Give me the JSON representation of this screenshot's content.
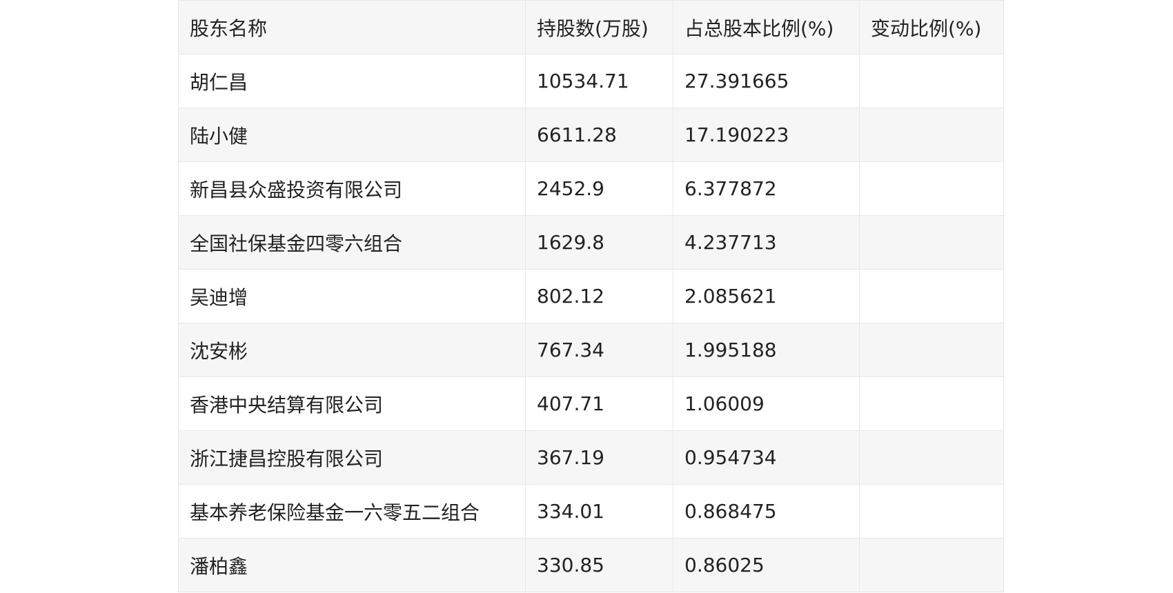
{
  "table": {
    "headers": [
      "股东名称",
      "持股数(万股)",
      "占总股本比例(%)",
      "变动比例(%)"
    ],
    "rows": [
      [
        "胡仁昌",
        "10534.71",
        "27.391665",
        ""
      ],
      [
        "陆小健",
        "6611.28",
        "17.190223",
        ""
      ],
      [
        "新昌县众盛投资有限公司",
        "2452.9",
        "6.377872",
        ""
      ],
      [
        "全国社保基金四零六组合",
        "1629.8",
        "4.237713",
        ""
      ],
      [
        "吴迪增",
        "802.12",
        "2.085621",
        ""
      ],
      [
        "沈安彬",
        "767.34",
        "1.995188",
        ""
      ],
      [
        "香港中央结算有限公司",
        "407.71",
        "1.06009",
        ""
      ],
      [
        "浙江捷昌控股有限公司",
        "367.19",
        "0.954734",
        ""
      ],
      [
        "基本养老保险基金一六零五二组合",
        "334.01",
        "0.868475",
        ""
      ],
      [
        "潘柏鑫",
        "330.85",
        "0.86025",
        ""
      ]
    ]
  }
}
